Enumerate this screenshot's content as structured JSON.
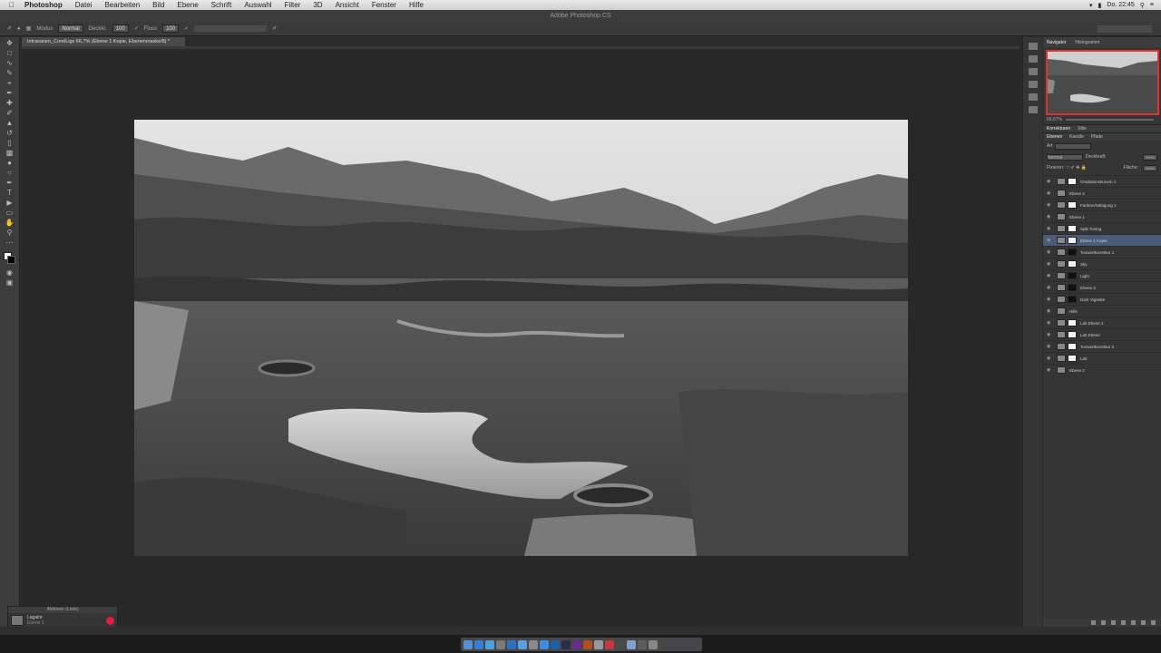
{
  "menubar": {
    "app": "Photoshop",
    "items": [
      "Datei",
      "Bearbeiten",
      "Bild",
      "Ebene",
      "Schrift",
      "Auswahl",
      "Filter",
      "3D",
      "Ansicht",
      "Fenster",
      "Hilfe"
    ],
    "clock": "Do. 22:45"
  },
  "window": {
    "title": "Adobe Photoshop CS"
  },
  "options": {
    "mode_label": "Modus",
    "mode_value": "Normal",
    "opacity_label": "Deckkr.",
    "opacity_value": "100",
    "flow_label": "Fluss",
    "flow_value": "100"
  },
  "document": {
    "tab_title": "Intrasanen_CorelLigs 66,7% (Ebene 1 Kopie, Ebenenmaske/8) *"
  },
  "panels": {
    "navigator_tab": "Navigator",
    "histogram_tab": "Histogramm",
    "zoom_value": "66,67%",
    "subtabs1": [
      "Korrekturen",
      "Stile"
    ],
    "subtabs2": [
      "Ebenen",
      "Kanäle",
      "Pfade"
    ],
    "kind_label": "Art",
    "blend_value": "Normal",
    "opacity_label": "Deckkraft:",
    "opacity_value": "100%",
    "lock_label": "Fixieren:",
    "fill_label": "Fläche:",
    "fill_value": "100%"
  },
  "layers": [
    {
      "name": "Gradationskurven 1",
      "mask": "light",
      "selected": false
    },
    {
      "name": "Ebene 4",
      "mask": "none",
      "selected": false
    },
    {
      "name": "Farbton/Sättigung 1",
      "mask": "light",
      "selected": false
    },
    {
      "name": "Ebene 1",
      "mask": "none",
      "selected": false
    },
    {
      "name": "Split Toning",
      "mask": "light",
      "selected": false
    },
    {
      "name": "Ebene 1 Kopie",
      "mask": "light",
      "selected": true
    },
    {
      "name": "Tonwertkorrektur 1",
      "mask": "dark",
      "selected": false
    },
    {
      "name": "Sky",
      "mask": "light",
      "selected": false
    },
    {
      "name": "Light",
      "mask": "dark",
      "selected": false
    },
    {
      "name": "Ebene 3",
      "mask": "dark",
      "selected": false
    },
    {
      "name": "Dark Vignette",
      "mask": "dark",
      "selected": false
    },
    {
      "name": "Hilfe",
      "mask": "none",
      "selected": false
    },
    {
      "name": "Lab Ebene 2",
      "mask": "light",
      "selected": false
    },
    {
      "name": "Lab Ebene",
      "mask": "light",
      "selected": false
    },
    {
      "name": "Tonwertkorrektur 2",
      "mask": "light",
      "selected": false
    },
    {
      "name": "Lab",
      "mask": "light",
      "selected": false
    },
    {
      "name": "Ebene 2",
      "mask": "none",
      "selected": false
    }
  ],
  "history": {
    "title": "Aktionen (Liste)",
    "item": "Lagaire",
    "sub": "Ebene 1"
  },
  "icons": [
    "apple-icon",
    "move-tool-icon",
    "brush-tool-icon",
    "eye-icon",
    "record-icon"
  ]
}
